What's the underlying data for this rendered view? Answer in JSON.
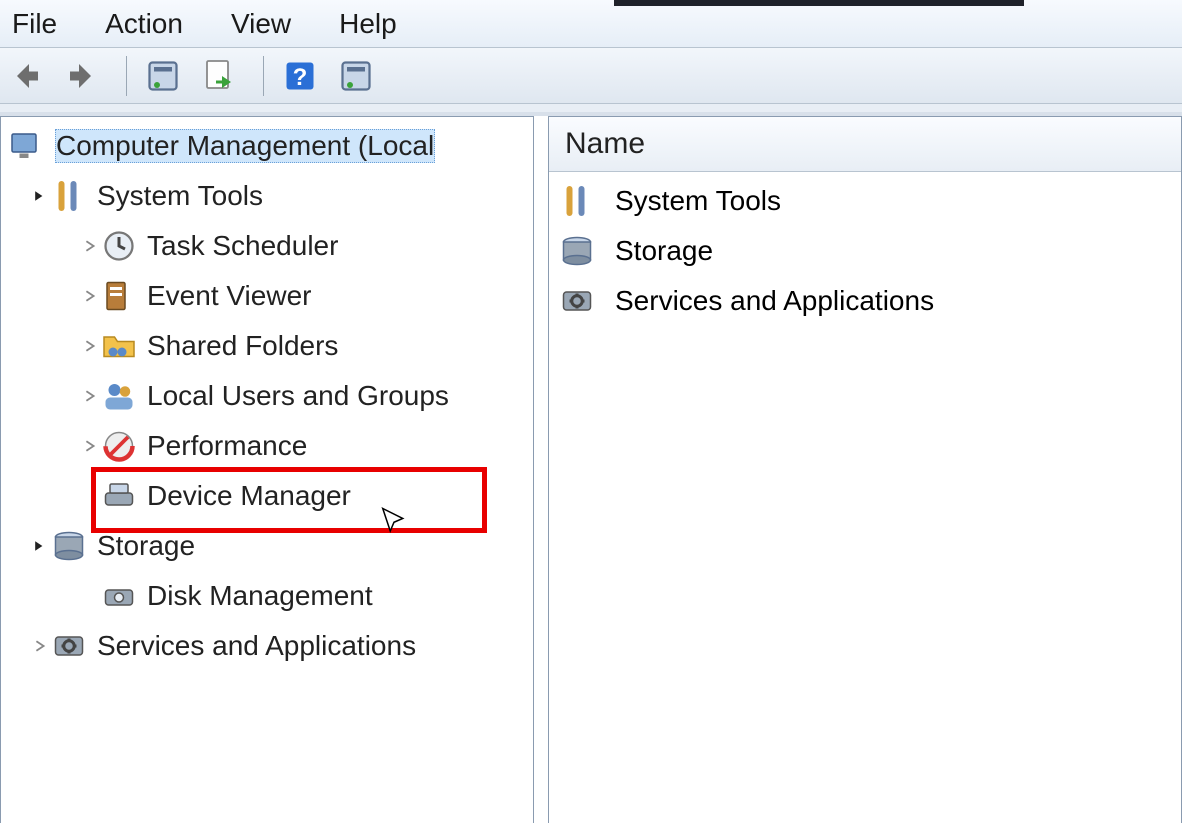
{
  "menu": {
    "file": "File",
    "action": "Action",
    "view": "View",
    "help": "Help"
  },
  "toolbar_icons": {
    "back": "back-icon",
    "forward": "forward-icon",
    "properties": "properties-icon",
    "export": "export-icon",
    "help": "help-icon",
    "refresh": "refresh-icon"
  },
  "tree": {
    "root": "Computer Management (Local",
    "system_tools": "System Tools",
    "task_scheduler": "Task Scheduler",
    "event_viewer": "Event Viewer",
    "shared_folders": "Shared Folders",
    "local_users": "Local Users and Groups",
    "performance": "Performance",
    "device_manager": "Device Manager",
    "storage": "Storage",
    "disk_management": "Disk Management",
    "services_apps": "Services and Applications"
  },
  "list": {
    "header": "Name",
    "items": {
      "system_tools": "System Tools",
      "storage": "Storage",
      "services_apps": "Services and Applications"
    }
  }
}
